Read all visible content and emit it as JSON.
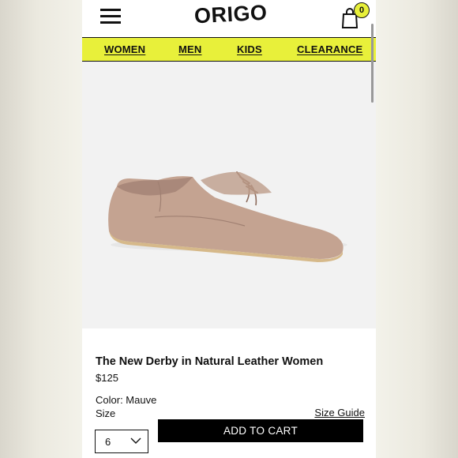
{
  "header": {
    "logo": "ORIGO",
    "cart_count": "0"
  },
  "nav": {
    "items": [
      "WOMEN",
      "MEN",
      "KIDS",
      "CLEARANCE"
    ]
  },
  "product": {
    "title": "The New Derby in Natural Leather Women",
    "price": "$125",
    "color": "Color: Mauve",
    "size_label": "Size",
    "size_guide": "Size Guide",
    "selected_size": "6",
    "add_to_cart": "ADD TO CART"
  },
  "colors": {
    "accent": "#e8f03a",
    "shoe": "#c8a895"
  }
}
